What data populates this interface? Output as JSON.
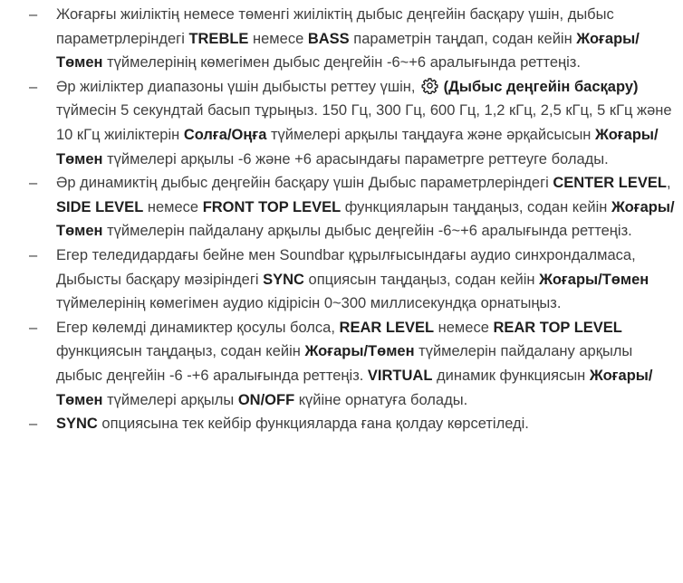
{
  "bullet_symbol": "–",
  "items": [
    {
      "segments": [
        {
          "t": "Жоғарғы жиіліктің немесе төменгі жиіліктің дыбыс деңгейін басқару үшін, дыбыс параметрлеріндегі ",
          "b": false
        },
        {
          "t": "TREBLE",
          "b": true
        },
        {
          "t": " немесе ",
          "b": false
        },
        {
          "t": "BASS",
          "b": true
        },
        {
          "t": " параметрін таңдап, содан кейін ",
          "b": false
        },
        {
          "t": "Жоғары/Төмен",
          "b": true
        },
        {
          "t": " түймелерінің көмегімен дыбыс деңгейін -6~+6 аралығында реттеңіз.",
          "b": false
        }
      ]
    },
    {
      "segments": [
        {
          "t": "Әр жиіліктер диапазоны үшін дыбысты реттеу үшін, ",
          "b": false
        },
        {
          "icon": "gear-icon"
        },
        {
          "t": " (Дыбыс деңгейін басқару)",
          "b": true
        },
        {
          "t": " түймесін 5 секундтай басып тұрыңыз. 150 Гц, 300 Гц, 600 Гц, 1,2 кГц, 2,5 кГц, 5 кГц және 10 кГц жиіліктерін ",
          "b": false
        },
        {
          "t": "Солға/Оңға",
          "b": true
        },
        {
          "t": " түймелері арқылы таңдауға және әрқайсысын ",
          "b": false
        },
        {
          "t": "Жоғары/Төмен",
          "b": true
        },
        {
          "t": " түймелері арқылы -6 және +6 арасындағы параметрге реттеуге болады.",
          "b": false
        }
      ]
    },
    {
      "segments": [
        {
          "t": "Әр динамиктің дыбыс деңгейін басқару үшін Дыбыс параметрлеріндегі ",
          "b": false
        },
        {
          "t": "CENTER LEVEL",
          "b": true
        },
        {
          "t": ", ",
          "b": false
        },
        {
          "t": "SIDE LEVEL",
          "b": true
        },
        {
          "t": " немесе ",
          "b": false
        },
        {
          "t": "FRONT TOP LEVEL",
          "b": true
        },
        {
          "t": " функцияларын таңдаңыз, содан кейін ",
          "b": false
        },
        {
          "t": "Жоғары/Төмен",
          "b": true
        },
        {
          "t": " түймелерін пайдалану арқылы дыбыс деңгейін -6~+6 аралығында реттеңіз.",
          "b": false
        }
      ]
    },
    {
      "segments": [
        {
          "t": "Егер теледидардағы бейне мен Soundbar құрылғысындағы аудио синхрондалмаса, Дыбысты басқару мәзіріндегі ",
          "b": false
        },
        {
          "t": "SYNC",
          "b": true
        },
        {
          "t": " опциясын таңдаңыз, содан кейін ",
          "b": false
        },
        {
          "t": "Жоғары/Төмен",
          "b": true
        },
        {
          "t": " түймелерінің көмегімен аудио кідірісін 0~300 миллисекундқа орнатыңыз.",
          "b": false
        }
      ]
    },
    {
      "segments": [
        {
          "t": "Егер көлемді динамиктер қосулы болса, ",
          "b": false
        },
        {
          "t": "REAR LEVEL",
          "b": true
        },
        {
          "t": " немесе ",
          "b": false
        },
        {
          "t": "REAR TOP LEVEL",
          "b": true
        },
        {
          "t": " функциясын таңдаңыз, содан кейін ",
          "b": false
        },
        {
          "t": "Жоғары/Төмен",
          "b": true
        },
        {
          "t": " түймелерін пайдалану арқылы дыбыс деңгейін -6 -+6 аралығында реттеңіз. ",
          "b": false
        },
        {
          "t": "VIRTUAL",
          "b": true
        },
        {
          "t": " динамик функциясын ",
          "b": false
        },
        {
          "t": "Жоғары/Төмен",
          "b": true
        },
        {
          "t": " түймелері арқылы ",
          "b": false
        },
        {
          "t": "ON/OFF",
          "b": true
        },
        {
          "t": " күйіне орнатуға болады.",
          "b": false
        }
      ]
    },
    {
      "segments": [
        {
          "t": "SYNC",
          "b": true
        },
        {
          "t": " опциясына тек кейбір функцияларда ғана қолдау көрсетіледі.",
          "b": false
        }
      ]
    }
  ]
}
